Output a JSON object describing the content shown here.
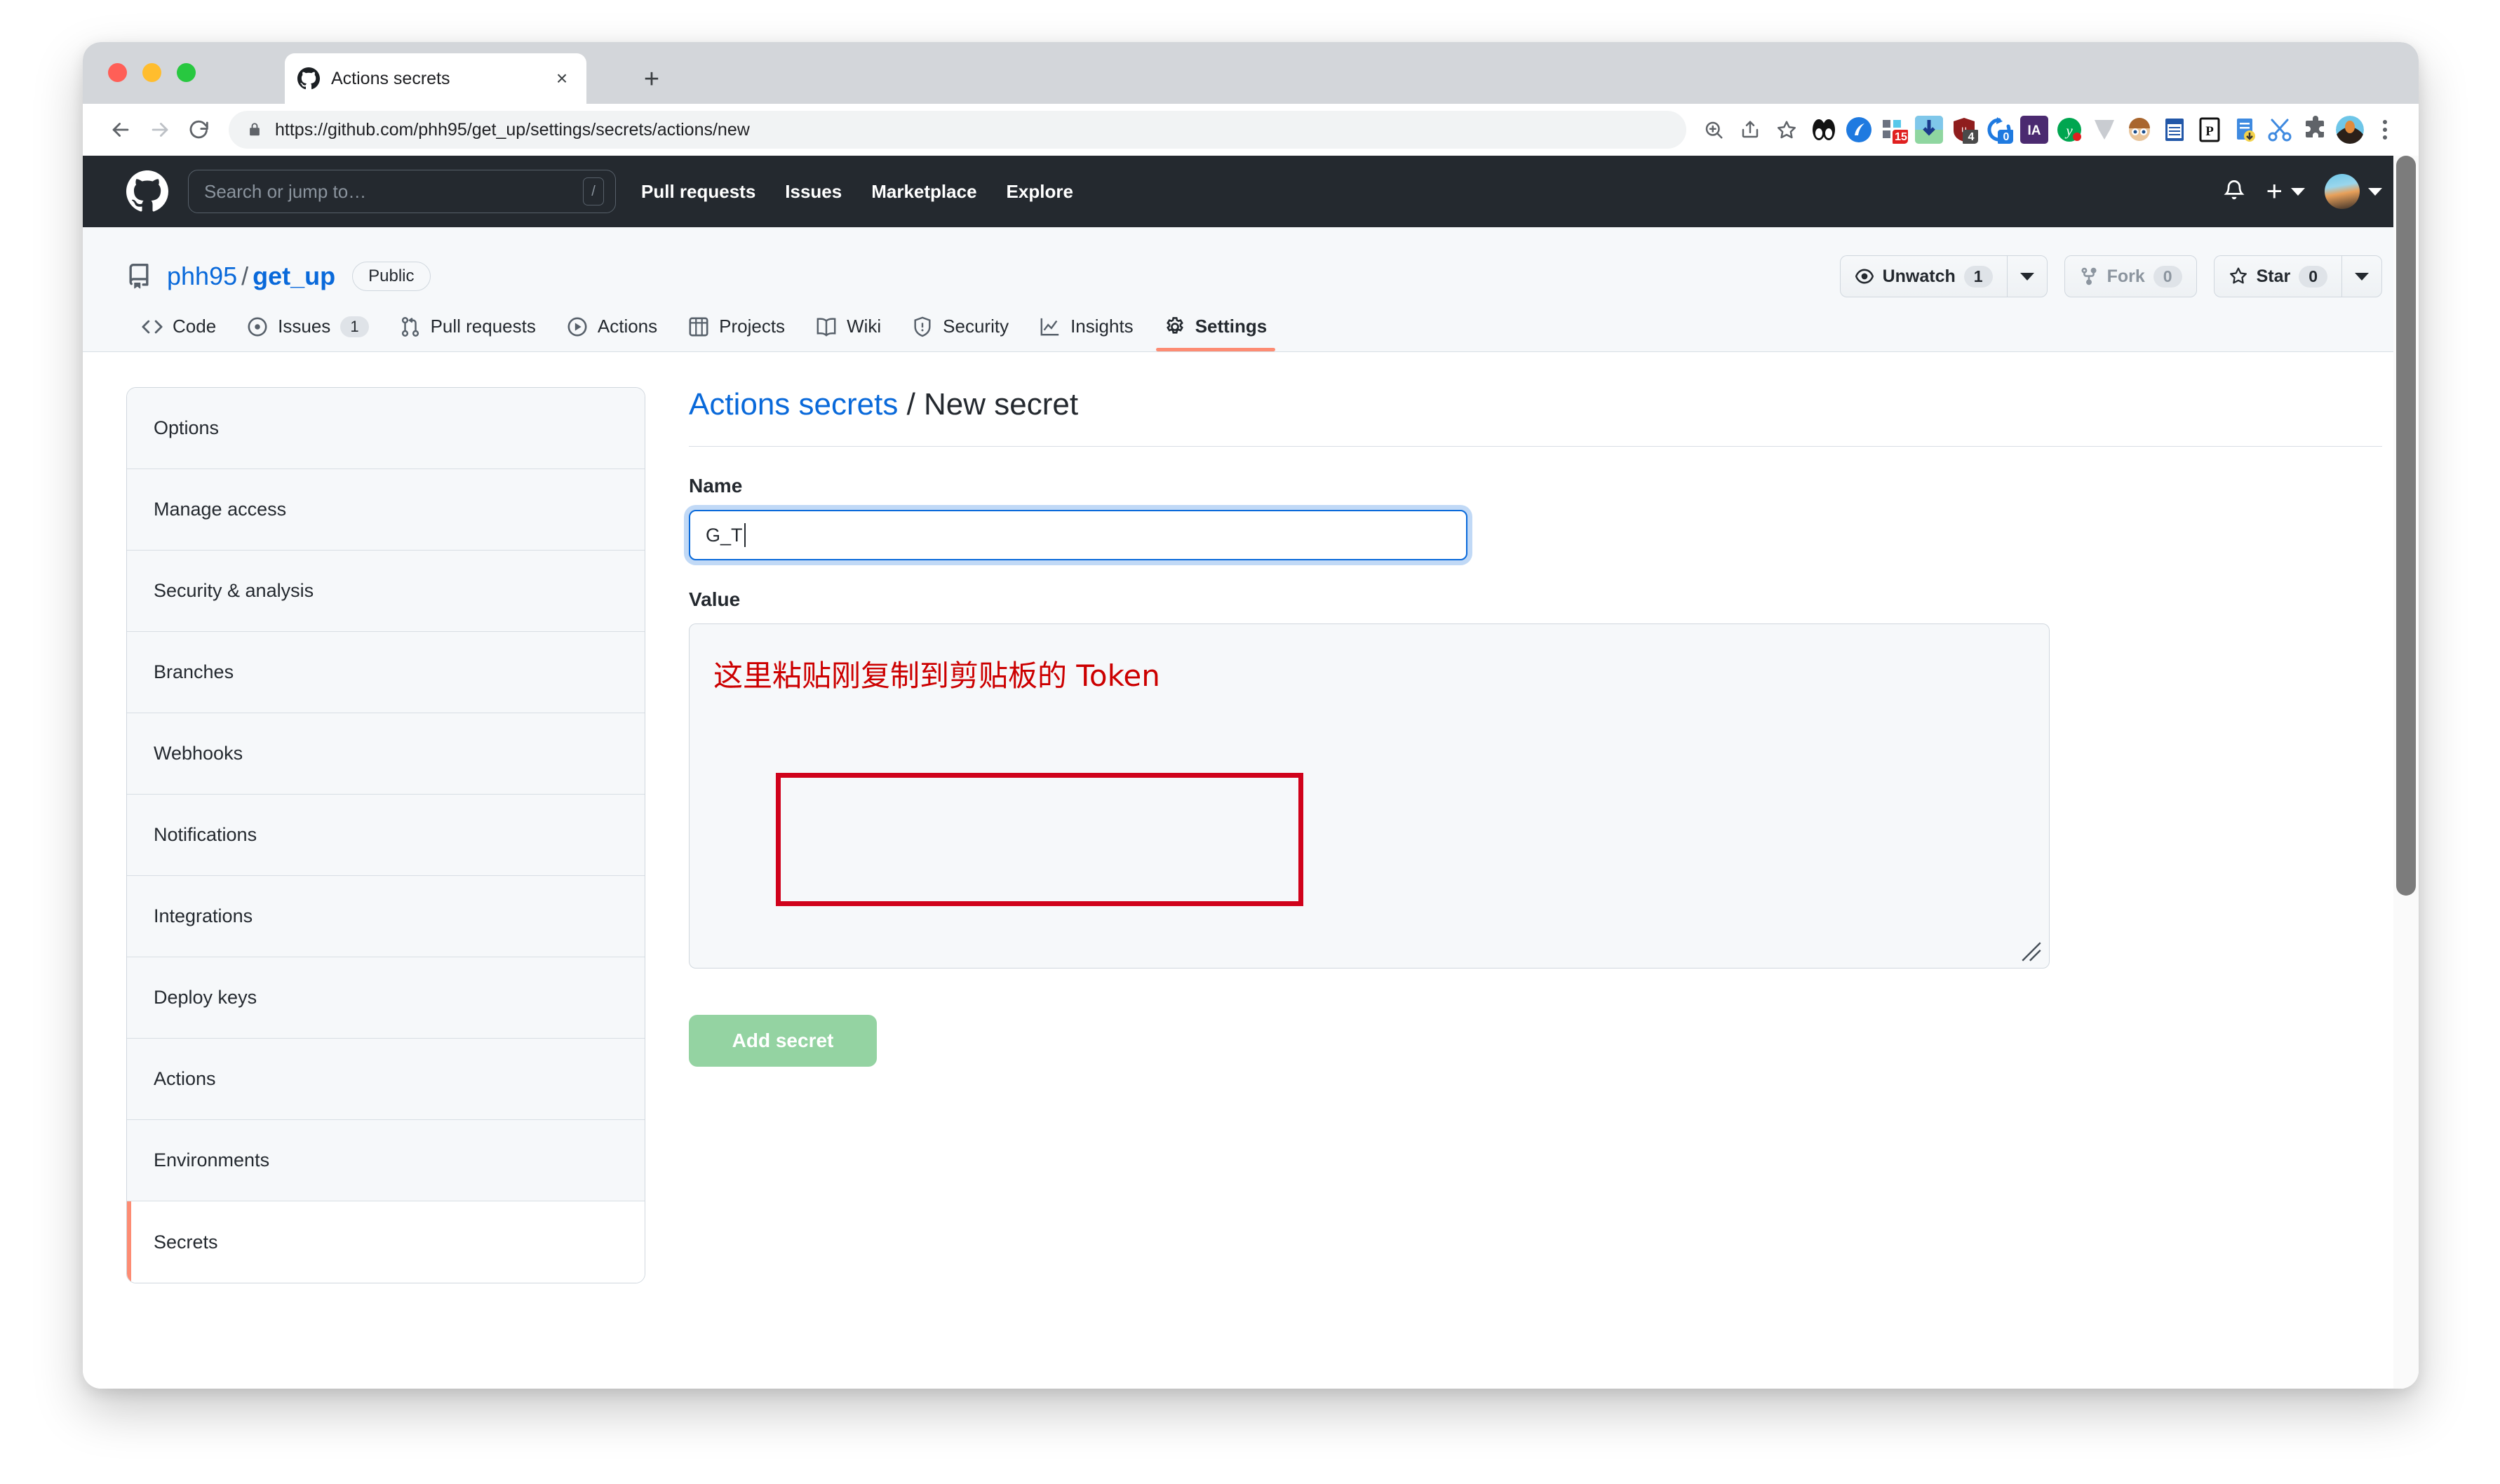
{
  "browser": {
    "tab": {
      "title": "Actions secrets",
      "favicon": "github-icon",
      "close": "×"
    },
    "new_tab_label": "+",
    "omnibox": {
      "url": "https://github.com/phh95/get_up/settings/secrets/actions/new",
      "lock_icon": "lock-icon"
    },
    "nav": {
      "back": "back-arrow-icon",
      "forward": "forward-arrow-icon",
      "reload": "reload-icon"
    },
    "omni_actions": [
      "zoom-icon",
      "share-icon",
      "bookmark-star-icon"
    ],
    "extensions": [
      {
        "name": "panda-extension",
        "color": "#ffffff",
        "badge": "",
        "badge_color": ""
      },
      {
        "name": "blue-circle-extension",
        "color": "#1f7ae0",
        "badge": "",
        "badge_color": ""
      },
      {
        "name": "blocks-extension",
        "color": "#6b7280",
        "badge": "15",
        "badge_color": "#e02020"
      },
      {
        "name": "download-manager-extension",
        "color": "#3f9ae0",
        "badge": "",
        "badge_color": ""
      },
      {
        "name": "shield-extension",
        "color": "#8f1d1d",
        "badge": "4",
        "badge_color": "#4a4a4a"
      },
      {
        "name": "refresh-extension",
        "color": "#1f7ae0",
        "badge": "0",
        "badge_color": "#1f7ae0"
      },
      {
        "name": "ia-extension",
        "color": "#4b2a70",
        "badge": "",
        "badge_color": ""
      },
      {
        "name": "yandex-extension",
        "color": "#00a650",
        "badge": "",
        "badge_color": ""
      },
      {
        "name": "chevron-extension",
        "color": "#c9ccd1",
        "badge": "",
        "badge_color": ""
      },
      {
        "name": "face-extension",
        "color": "#e0b48f",
        "badge": "",
        "badge_color": ""
      },
      {
        "name": "notebook-extension",
        "color": "#2257a8",
        "badge": "",
        "badge_color": ""
      },
      {
        "name": "p-box-extension",
        "color": "#ffffff",
        "badge": "",
        "badge_color": ""
      },
      {
        "name": "document-download-extension",
        "color": "#3f8ae0",
        "badge": "",
        "badge_color": ""
      },
      {
        "name": "scissors-extension",
        "color": "#3f8ae0",
        "badge": "",
        "badge_color": ""
      },
      {
        "name": "puzzle-extensions-menu",
        "color": "#5f6368",
        "badge": "",
        "badge_color": ""
      },
      {
        "name": "profile-avatar",
        "color": "#6ec6e8",
        "badge": "",
        "badge_color": ""
      }
    ],
    "menu_icon": "kebab-menu-icon"
  },
  "github_header": {
    "logo": "github-mark-icon",
    "search": {
      "placeholder": "Search or jump to…",
      "shortcut": "/"
    },
    "nav": [
      {
        "label": "Pull requests"
      },
      {
        "label": "Issues"
      },
      {
        "label": "Marketplace"
      },
      {
        "label": "Explore"
      }
    ],
    "notifications_icon": "bell-icon",
    "create_new_label": "+",
    "avatar": "user-avatar"
  },
  "repo": {
    "owner": "phh95",
    "separator": "/",
    "name": "get_up",
    "visibility": "Public",
    "actions": [
      {
        "name": "unwatch",
        "label": "Unwatch",
        "count": "1",
        "icon": "eye-icon",
        "muted": false
      },
      {
        "name": "fork",
        "label": "Fork",
        "count": "0",
        "icon": "fork-icon",
        "muted": true
      },
      {
        "name": "star",
        "label": "Star",
        "count": "0",
        "icon": "star-icon",
        "muted": false
      }
    ],
    "tabs": [
      {
        "label": "Code",
        "icon": "code-icon",
        "count": "",
        "active": false
      },
      {
        "label": "Issues",
        "icon": "issue-opened-icon",
        "count": "1",
        "active": false
      },
      {
        "label": "Pull requests",
        "icon": "git-pull-request-icon",
        "count": "",
        "active": false
      },
      {
        "label": "Actions",
        "icon": "play-icon",
        "count": "",
        "active": false
      },
      {
        "label": "Projects",
        "icon": "project-board-icon",
        "count": "",
        "active": false
      },
      {
        "label": "Wiki",
        "icon": "book-icon",
        "count": "",
        "active": false
      },
      {
        "label": "Security",
        "icon": "shield-icon",
        "count": "",
        "active": false
      },
      {
        "label": "Insights",
        "icon": "graph-icon",
        "count": "",
        "active": false
      },
      {
        "label": "Settings",
        "icon": "gear-icon",
        "count": "",
        "active": true
      }
    ]
  },
  "sidebar": {
    "items": [
      {
        "label": "Options",
        "selected": false
      },
      {
        "label": "Manage access",
        "selected": false
      },
      {
        "label": "Security & analysis",
        "selected": false
      },
      {
        "label": "Branches",
        "selected": false
      },
      {
        "label": "Webhooks",
        "selected": false
      },
      {
        "label": "Notifications",
        "selected": false
      },
      {
        "label": "Integrations",
        "selected": false
      },
      {
        "label": "Deploy keys",
        "selected": false
      },
      {
        "label": "Actions",
        "selected": false
      },
      {
        "label": "Environments",
        "selected": false
      },
      {
        "label": "Secrets",
        "selected": true
      }
    ]
  },
  "main": {
    "heading_link": "Actions secrets",
    "heading_sep": " / ",
    "heading_current": "New secret",
    "name_label": "Name",
    "name_value": "G_T",
    "value_label": "Value",
    "value_text": "这里粘贴刚复制到剪贴板的 Token",
    "submit_label": "Add secret"
  },
  "annotation": {
    "box_color": "#d0021b",
    "note_color": "#cc0000"
  },
  "colors": {
    "github_dark": "#24292f",
    "link_blue": "#0969da",
    "accent_orange": "#fd8c73",
    "button_green_disabled": "#94d3a2",
    "page_bg": "#f6f8fa"
  }
}
